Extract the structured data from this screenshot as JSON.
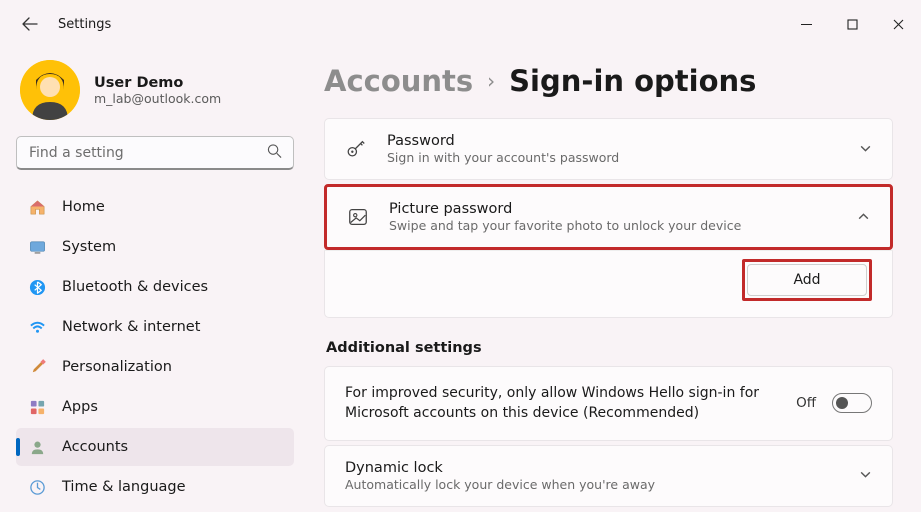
{
  "window": {
    "title": "Settings"
  },
  "user": {
    "name": "User Demo",
    "email": "m_lab@outlook.com"
  },
  "search": {
    "placeholder": "Find a setting"
  },
  "nav": {
    "items": [
      {
        "label": "Home"
      },
      {
        "label": "System"
      },
      {
        "label": "Bluetooth & devices"
      },
      {
        "label": "Network & internet"
      },
      {
        "label": "Personalization"
      },
      {
        "label": "Apps"
      },
      {
        "label": "Accounts"
      },
      {
        "label": "Time & language"
      }
    ]
  },
  "breadcrumb": {
    "parent": "Accounts",
    "current": "Sign-in options"
  },
  "options": {
    "password": {
      "title": "Password",
      "sub": "Sign in with your account's password"
    },
    "picture": {
      "title": "Picture password",
      "sub": "Swipe and tap your favorite photo to unlock your device",
      "add_label": "Add"
    }
  },
  "additional": {
    "heading": "Additional settings",
    "hello": {
      "text": "For improved security, only allow Windows Hello sign-in for Microsoft accounts on this device (Recommended)",
      "state": "Off"
    },
    "dynamic": {
      "title": "Dynamic lock",
      "sub": "Automatically lock your device when you're away"
    }
  }
}
